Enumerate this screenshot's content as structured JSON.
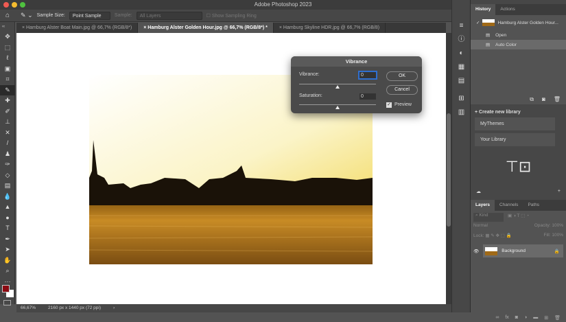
{
  "app": {
    "title": "Adobe Photoshop 2023"
  },
  "options": {
    "sample_size_label": "Sample Size:",
    "sample_size_value": "Point Sample",
    "sample_label": "Sample:",
    "sample_value": "All Layers",
    "show_ring": "Show Sampling Ring"
  },
  "tabs": [
    {
      "label": "Hamburg Alster Boat Main.jpg @ 66,7% (RGB/8*)",
      "active": false
    },
    {
      "label": "Hamburg Alster Golden Hour.jpg @ 66,7% (RGB/8*) *",
      "active": true
    },
    {
      "label": "Hamburg Skyline HDR.jpg @ 66,7% (RGB/8)",
      "active": false
    }
  ],
  "status": {
    "zoom": "66,67%",
    "doc_size": "2160 px x 1440 px (72 ppi)",
    "arrow": "›"
  },
  "dialog": {
    "title": "Vibrance",
    "vibrance_label": "Vibrance:",
    "vibrance_value": "0",
    "saturation_label": "Saturation:",
    "saturation_value": "0",
    "ok": "OK",
    "cancel": "Cancel",
    "preview": "Preview",
    "preview_checked": true,
    "vibrance_slider": 0.5,
    "saturation_slider": 0.5
  },
  "history": {
    "tab": "History",
    "tab2": "Actions",
    "snapshot": "Hamburg Alster Golden Hour...",
    "items": [
      "Open",
      "Auto Color"
    ]
  },
  "libraries": {
    "create": "Create new library",
    "items": [
      "MyThemes",
      "Your Library"
    ]
  },
  "layers": {
    "tabs": [
      "Layers",
      "Channels",
      "Paths"
    ],
    "kind": "Kind",
    "blend": "Normal",
    "opacity_label": "Opacity:",
    "opacity": "100%",
    "lock_label": "Lock:",
    "fill_label": "Fill:",
    "fill": "100%",
    "layer": "Background"
  },
  "colors": {
    "foreground": "#8b0a12",
    "background": "#ffffff",
    "accent": "#2f6fd0"
  }
}
